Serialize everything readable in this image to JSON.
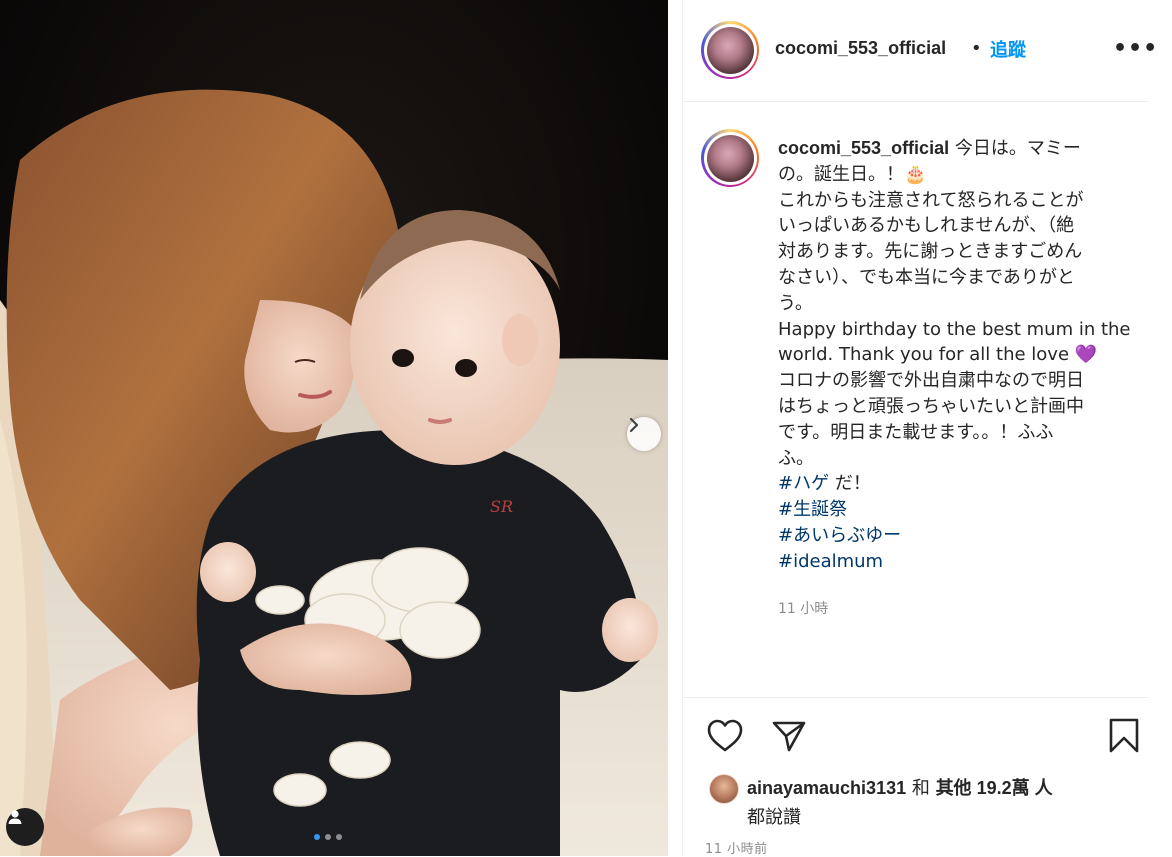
{
  "post": {
    "username": "cocomi_553_official",
    "dot": "•",
    "follow_label": "追蹤",
    "more_label": "•••"
  },
  "caption": {
    "username": "cocomi_553_official",
    "lines": [
      "今日は。マミー",
      "の。誕生日。！🎂",
      "これからも注意されて怒られることが",
      "いっぱいあるかもしれませんが、（絶",
      "対あります。先に謝っときますごめん",
      "なさい）、でも本当に今までありがと",
      "う。",
      "Happy birthday to the best mum in the",
      "world. Thank you for all the love 💜",
      "コロナの影響で外出自粛中なので明日",
      "はちょっと頑張っちゃいたいと計画中",
      "です。明日また載せます。。！ふふ",
      "ふ。"
    ],
    "hashtag1": "#ハゲ",
    "hashtag1_suffix": " だ！",
    "hashtag2": "#生誕祭",
    "hashtag3": "#あいらぶゆー",
    "hashtag4": "#idealmum",
    "time": "11 小時"
  },
  "likes": {
    "liker": "ainayamauchi3131",
    "and": " 和 ",
    "others": "其他 19.2萬 人",
    "suffix": "都說讚"
  },
  "post_time": "11 小時前",
  "icons": {
    "like": "heart-icon",
    "share": "send-icon",
    "save": "bookmark-icon",
    "next": "chevron-right-icon",
    "tag": "user-icon"
  },
  "carousel": {
    "total": 3,
    "active": 1
  }
}
